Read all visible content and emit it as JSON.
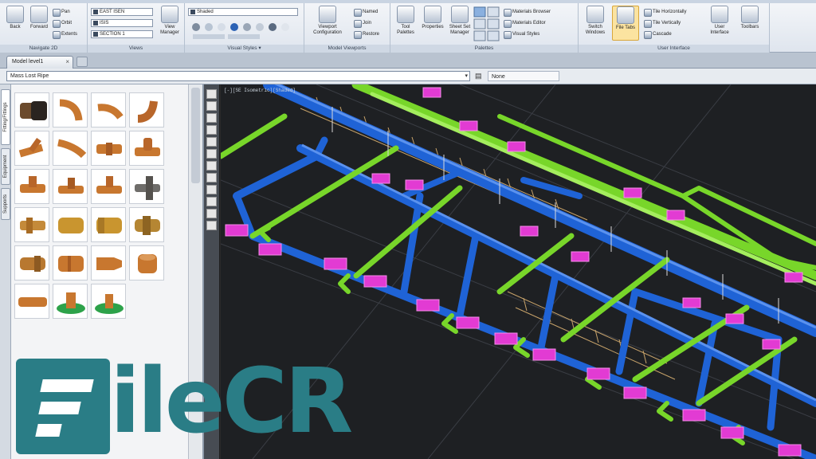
{
  "ribbon": {
    "navigate": {
      "title": "Navigate 2D",
      "back": "Back",
      "forward": "Forward",
      "pan": "Pan",
      "orbit": "Orbit",
      "extents": "Extents"
    },
    "views": {
      "title": "Views",
      "items": [
        "EAST ISEN",
        "ISIS",
        "SECTION 1"
      ],
      "view_manager": "View Manager"
    },
    "visual_styles": {
      "title": "Visual Styles",
      "current": "Shaded",
      "launcher": "▾"
    },
    "model_viewports": {
      "title": "Model Viewports",
      "viewport_config": "Viewport Configuration",
      "named": "Named",
      "join": "Join",
      "restore": "Restore"
    },
    "palettes": {
      "title": "Palettes",
      "tool_palettes": "Tool Palettes",
      "properties": "Properties",
      "sheet_set_manager": "Sheet Set Manager",
      "materials_browser": "Materials Browser",
      "materials_editor": "Materials Editor",
      "visual_styles": "Visual Styles"
    },
    "user_interface": {
      "title": "User Interface",
      "switch_windows": "Switch Windows",
      "file_tabs": "File Tabs",
      "tile_horizontally": "Tile Horizontally",
      "tile_vertically": "Tile Vertically",
      "cascade": "Cascade",
      "user_interface": "User Interface",
      "toolbars": "Toolbars"
    }
  },
  "tabs": {
    "document_tab": "Model level1",
    "close_glyph": "×"
  },
  "filterbar": {
    "filter_value": "Mass Lost Ripe",
    "dropdown_glyph": "▾",
    "view_value": "None"
  },
  "palette": {
    "vertical_tabs": [
      "Fitting/Fittings",
      "Equipment",
      "Supports"
    ]
  },
  "viewport": {
    "label": "[-][SE Isometric][Shaded]"
  },
  "colors": {
    "ducts": "#1f63d6",
    "pipes": "#78d62a",
    "supports": "#e23bd3",
    "trays": "#c8a36a",
    "watermark": "#2a7d86"
  },
  "watermark": {
    "text": "ileCR"
  }
}
